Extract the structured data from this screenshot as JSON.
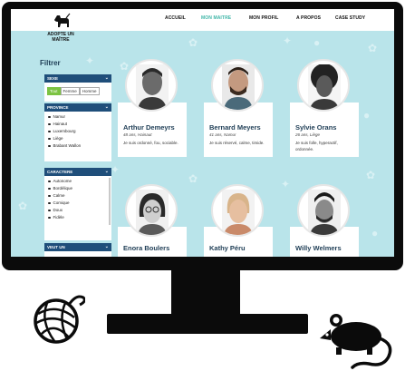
{
  "site": {
    "logo_line1": "ADOPTE UN",
    "logo_line2": "MAÎTRE"
  },
  "nav": [
    "ACCUEIL",
    "MON MAITRE",
    "MON PROFIL",
    "A PROPOS",
    "CASE STUDY"
  ],
  "nav_active_color": "#3fb6a8",
  "filter": {
    "title": "Filtrer",
    "sexe": {
      "heading": "SEXE",
      "options": [
        "Tout",
        "Femme",
        "Homme"
      ],
      "selected": "Tout"
    },
    "province": {
      "heading": "PROVINCE",
      "items": [
        "Namur",
        "Hainaut",
        "Luxembourg",
        "Liège",
        "Brabant Wallon"
      ]
    },
    "caractere": {
      "heading": "CARACTERE",
      "items": [
        "Autonome",
        "Bordélique",
        "Calme",
        "Comique",
        "Doux",
        "Fidèle"
      ]
    },
    "veut_un": {
      "heading": "VEUT UN"
    }
  },
  "profiles": [
    {
      "name": "Arthur Demeyrs",
      "meta": "48 ans, Hainaut",
      "desc": "Je suis ordonné, fou, sociable."
    },
    {
      "name": "Bernard Meyers",
      "meta": "41 ans, Namur",
      "desc": "Je suis réservé, calme, timide."
    },
    {
      "name": "Sylvie Orans",
      "meta": "26 ans, Liège",
      "desc": "Je suis folle, hyperactif, ordonnée."
    },
    {
      "name": "Enora Boulers",
      "meta": "",
      "desc": ""
    },
    {
      "name": "Kathy Péru",
      "meta": "",
      "desc": ""
    },
    {
      "name": "Willy Welmers",
      "meta": "",
      "desc": ""
    }
  ],
  "colors": {
    "background": "#b9e4ea",
    "filter_header": "#1f4e7a",
    "accent_green": "#7cc342",
    "name_text": "#1e3d55"
  },
  "icons": [
    "dog-logo-icon",
    "chevron-down-icon",
    "yarn-ball-icon",
    "rat-icon",
    "paw-pattern-icon",
    "bone-pattern-icon"
  ]
}
